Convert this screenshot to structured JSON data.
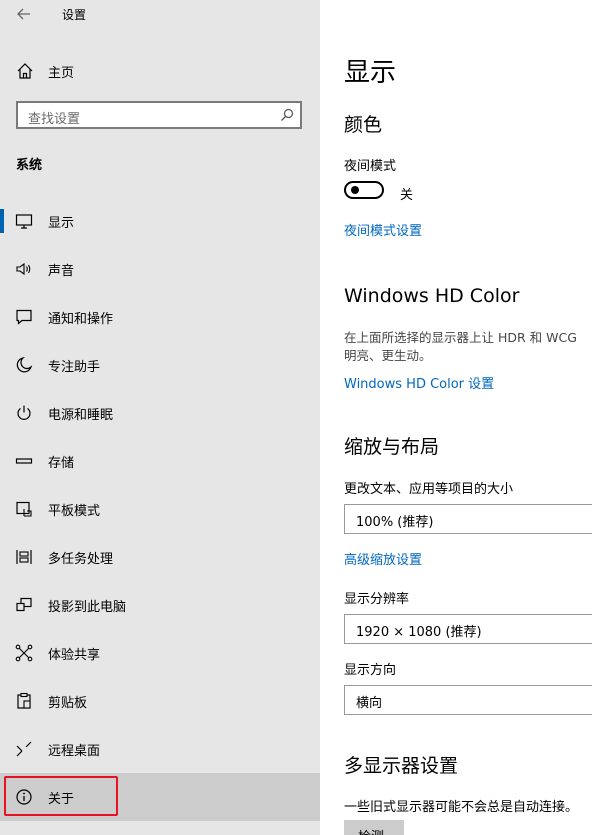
{
  "window": {
    "title": "设置"
  },
  "sidebar": {
    "home_label": "主页",
    "search_placeholder": "查找设置",
    "section_title": "系统",
    "items": [
      {
        "label": "显示",
        "icon": "monitor-icon"
      },
      {
        "label": "声音",
        "icon": "speaker-icon"
      },
      {
        "label": "通知和操作",
        "icon": "notification-icon"
      },
      {
        "label": "专注助手",
        "icon": "moon-icon"
      },
      {
        "label": "电源和睡眠",
        "icon": "power-icon"
      },
      {
        "label": "存储",
        "icon": "storage-icon"
      },
      {
        "label": "平板模式",
        "icon": "tablet-icon"
      },
      {
        "label": "多任务处理",
        "icon": "multitask-icon"
      },
      {
        "label": "投影到此电脑",
        "icon": "project-icon"
      },
      {
        "label": "体验共享",
        "icon": "share-icon"
      },
      {
        "label": "剪贴板",
        "icon": "clipboard-icon"
      },
      {
        "label": "远程桌面",
        "icon": "remote-icon"
      },
      {
        "label": "关于",
        "icon": "info-icon"
      }
    ]
  },
  "main": {
    "title": "显示",
    "color_heading": "颜色",
    "night_light_label": "夜间模式",
    "night_light_state": "关",
    "night_light_settings_link": "夜间模式设置",
    "hdr_heading": "Windows HD Color",
    "hdr_desc_line1": "在上面所选择的显示器上让 HDR 和 WCG",
    "hdr_desc_line2": "明亮、更生动。",
    "hdr_link": "Windows HD Color 设置",
    "scale_heading": "缩放与布局",
    "scale_label": "更改文本、应用等项目的大小",
    "scale_value": "100% (推荐)",
    "advanced_scale_link": "高级缩放设置",
    "resolution_label": "显示分辨率",
    "resolution_value": "1920 × 1080 (推荐)",
    "orientation_label": "显示方向",
    "orientation_value": "横向",
    "multi_heading": "多显示器设置",
    "multi_desc": "一些旧式显示器可能不会总是自动连接。",
    "detect_button": "检测"
  },
  "colors": {
    "accent": "#0067c0",
    "highlight_box": "#e81123",
    "sidebar_bg": "#e6e6e6"
  }
}
